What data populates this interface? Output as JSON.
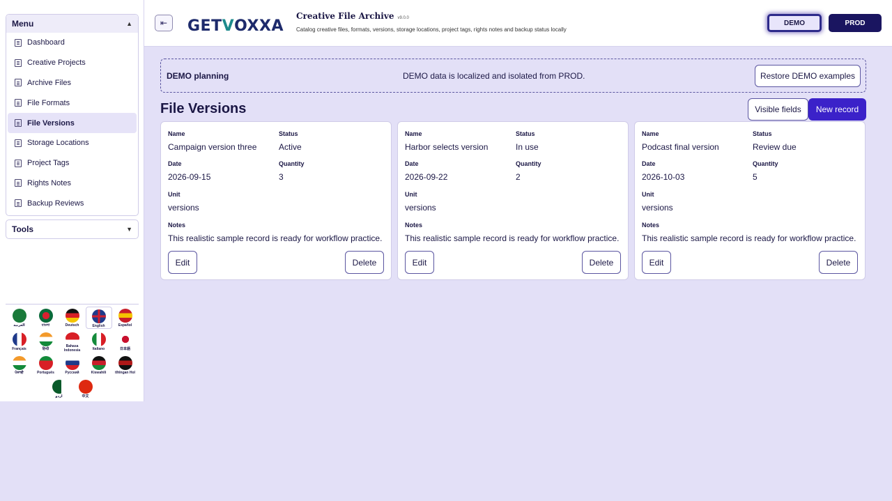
{
  "sidebar": {
    "menu_title": "Menu",
    "tools_title": "Tools",
    "items": [
      {
        "label": "Dashboard",
        "active": false
      },
      {
        "label": "Creative Projects",
        "active": false
      },
      {
        "label": "Archive Files",
        "active": false
      },
      {
        "label": "File Formats",
        "active": false
      },
      {
        "label": "File Versions",
        "active": true
      },
      {
        "label": "Storage Locations",
        "active": false
      },
      {
        "label": "Project Tags",
        "active": false
      },
      {
        "label": "Rights Notes",
        "active": false
      },
      {
        "label": "Backup Reviews",
        "active": false
      }
    ],
    "languages": [
      {
        "label": "العربية",
        "flag": "sa",
        "colors": [
          "#1a7a3a",
          "#1a7a3a",
          "#1a7a3a"
        ]
      },
      {
        "label": "বাংলা",
        "flag": "bd",
        "colors": [
          "#0a6a3a",
          "#d82030",
          "#0a6a3a"
        ]
      },
      {
        "label": "Deutsch",
        "flag": "de",
        "colors": [
          "#111111",
          "#d81f26",
          "#f5c400"
        ]
      },
      {
        "label": "English",
        "flag": "gb",
        "colors": [
          "#1f3a8a",
          "#cf2030",
          "#ffffff"
        ],
        "active": true
      },
      {
        "label": "Español",
        "flag": "es",
        "colors": [
          "#c81e2a",
          "#f5c400",
          "#c81e2a"
        ]
      },
      {
        "label": "Français",
        "flag": "fr",
        "colors": [
          "#1f3a8a",
          "#ffffff",
          "#d81f26"
        ]
      },
      {
        "label": "हिन्दी",
        "flag": "in",
        "colors": [
          "#f39a2b",
          "#ffffff",
          "#138a3a"
        ]
      },
      {
        "label": "Bahasa Indonesia",
        "flag": "id",
        "colors": [
          "#d81f26",
          "#d81f26",
          "#ffffff"
        ]
      },
      {
        "label": "Italiano",
        "flag": "it",
        "colors": [
          "#138a3a",
          "#ffffff",
          "#d81f26"
        ]
      },
      {
        "label": "日本語",
        "flag": "jp",
        "colors": [
          "#ffffff",
          "#c8102e",
          "#ffffff"
        ]
      },
      {
        "label": "ਪੰਜਾਬੀ",
        "flag": "in2",
        "colors": [
          "#f39a2b",
          "#ffffff",
          "#138a3a"
        ]
      },
      {
        "label": "Português",
        "flag": "pt",
        "colors": [
          "#138a3a",
          "#d81f26",
          "#d81f26"
        ]
      },
      {
        "label": "Русский",
        "flag": "ru",
        "colors": [
          "#ffffff",
          "#1f3a8a",
          "#d81f26"
        ]
      },
      {
        "label": "Kiswahili",
        "flag": "ke",
        "colors": [
          "#111111",
          "#c81e2a",
          "#138a3a"
        ]
      },
      {
        "label": "tlhIngan Hol",
        "flag": "kl",
        "colors": [
          "#111111",
          "#b01818",
          "#111111"
        ]
      },
      {
        "label": "اردو",
        "flag": "pk",
        "colors": [
          "#0a5a2a",
          "#0a5a2a",
          "#ffffff"
        ]
      },
      {
        "label": "中文",
        "flag": "cn",
        "colors": [
          "#de2910",
          "#de2910",
          "#de2910"
        ]
      }
    ]
  },
  "header": {
    "collapse_icon": "⇤",
    "logo_text": {
      "pre": "GET",
      "v": "V",
      "post": "OXXA"
    },
    "app_title": "Creative File Archive",
    "version": "v9.0.0",
    "subtitle": "Catalog creative files, formats, versions, storage locations, project tags, rights notes and backup status locally",
    "demo_label": "DEMO",
    "prod_label": "PROD"
  },
  "banner": {
    "title": "DEMO planning",
    "message": "DEMO data is localized and isolated from PROD.",
    "restore_label": "Restore DEMO examples"
  },
  "main": {
    "title": "File Versions",
    "visible_fields_label": "Visible fields",
    "new_record_label": "New record",
    "labels": {
      "name": "Name",
      "status": "Status",
      "date": "Date",
      "quantity": "Quantity",
      "unit": "Unit",
      "notes": "Notes",
      "edit": "Edit",
      "delete": "Delete"
    },
    "records": [
      {
        "name": "Campaign version three",
        "status": "Active",
        "date": "2026-09-15",
        "quantity": "3",
        "unit": "versions",
        "notes": "This realistic sample record is ready for workflow practice."
      },
      {
        "name": "Harbor selects version",
        "status": "In use",
        "date": "2026-09-22",
        "quantity": "2",
        "unit": "versions",
        "notes": "This realistic sample record is ready for workflow practice."
      },
      {
        "name": "Podcast final version",
        "status": "Review due",
        "date": "2026-10-03",
        "quantity": "5",
        "unit": "versions",
        "notes": "This realistic sample record is ready for workflow practice."
      }
    ]
  },
  "colors": {
    "accent": "#3b22c9",
    "prod": "#1a1560",
    "background": "#e3e0f7"
  }
}
